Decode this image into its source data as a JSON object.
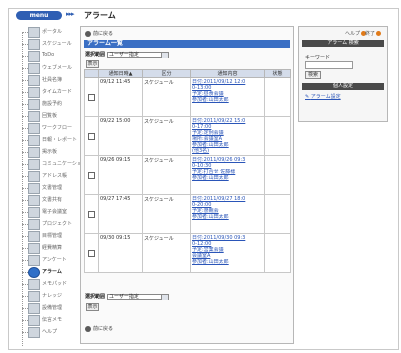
{
  "header": {
    "menu_label": "menu",
    "arrows": "▸▸▸",
    "title": "アラーム"
  },
  "sidebar": {
    "items": [
      {
        "label": "ポータル"
      },
      {
        "label": "スケジュール"
      },
      {
        "label": "ToDo"
      },
      {
        "label": "ウェブメール"
      },
      {
        "label": "社員名簿"
      },
      {
        "label": "タイムカード"
      },
      {
        "label": "施設予約"
      },
      {
        "label": "回覧板"
      },
      {
        "label": "ワークフロー"
      },
      {
        "label": "日報・レポート"
      },
      {
        "label": "掲示板"
      },
      {
        "label": "コミュニケーション"
      },
      {
        "label": "アドレス帳"
      },
      {
        "label": "文書管理"
      },
      {
        "label": "文書共有"
      },
      {
        "label": "電子会議室"
      },
      {
        "label": "プロジェクト"
      },
      {
        "label": "目標管理"
      },
      {
        "label": "経費精算"
      },
      {
        "label": "アンケート"
      },
      {
        "label": "アラーム",
        "active": true
      },
      {
        "label": "メモパッド"
      },
      {
        "label": "ナレッジ"
      },
      {
        "label": "設備管理"
      },
      {
        "label": "伝言メモ"
      },
      {
        "label": "ヘルプ"
      }
    ]
  },
  "main": {
    "back_label": "前に戻る",
    "list_title": "アラーム一覧",
    "filter": {
      "label": "選択範囲",
      "value": "ユーザー指定"
    },
    "submit_label": "表示",
    "table": {
      "headers": [
        "",
        "通知日時▲",
        "区分",
        "通知内容",
        "状態"
      ],
      "rows": [
        {
          "datetime": "09/12 11:45",
          "type": "スケジュール",
          "lines": [
            "日付:2011/09/12 12:0",
            "0-13:00",
            "予定:昼食会議",
            "参加者:山田太郎"
          ]
        },
        {
          "datetime": "09/22 15:00",
          "type": "スケジュール",
          "lines": [
            "日付:2011/09/22 15:0",
            "0-17:00",
            "予定:定例会議",
            "場所:会議室A",
            "参加者:山田太郎",
            "",
            "(他3名)"
          ]
        },
        {
          "datetime": "09/26 09:15",
          "type": "スケジュール",
          "lines": [
            "日付:2011/09/26 09:3",
            "0-10:30",
            "予定:打合せ 佐藤様",
            "参加者:山田太郎"
          ]
        },
        {
          "datetime": "09/27 17:45",
          "type": "スケジュール",
          "lines": [
            "日付:2011/09/27 18:0",
            "0-20:00",
            "予定:懇親会",
            "参加者:山田太郎"
          ]
        },
        {
          "datetime": "09/30 09:15",
          "type": "スケジュール",
          "lines": [
            "日付:2011/09/30 09:3",
            "0-12:00",
            "予定:営業会議",
            "会議室A",
            "参加者:山田太郎"
          ]
        }
      ]
    },
    "bottom_filter": {
      "label": "選択範囲",
      "value": "ユーザー指定"
    },
    "bottom_submit": "表示",
    "bottom_back": "前に戻る"
  },
  "right_panel": {
    "help_label": "ヘルプ",
    "logout_label": "終了",
    "search_header": "アラーム 検索",
    "keyword_label": "キーワード",
    "search_button": "検索",
    "settings_header": "個人設定",
    "settings_link": "アラーム設定"
  },
  "colors": {
    "accent": "#3a6fc4",
    "header_dark": "#4a4a4a",
    "link": "#2a55b8"
  }
}
